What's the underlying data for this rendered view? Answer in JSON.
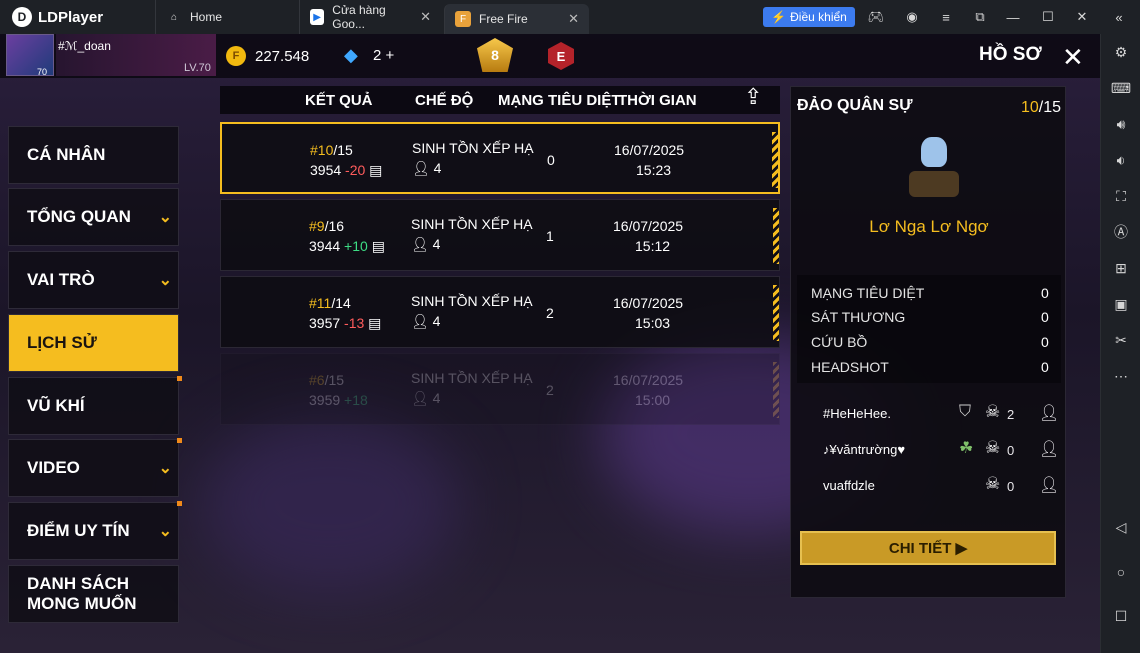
{
  "app": {
    "name": "LDPlayer"
  },
  "tabs": [
    {
      "label": "Home",
      "icon": "home-icon"
    },
    {
      "label": "Cửa hàng Goo...",
      "icon": "play-store-icon"
    },
    {
      "label": "Free Fire",
      "icon": "free-fire-icon"
    }
  ],
  "window": {
    "control_label": "Điều khiển"
  },
  "profile": {
    "name": "#ℳ_doan",
    "level_badge": "70",
    "level": "LV.70",
    "coins": "227.548",
    "diamonds": "2",
    "rank_number": "8",
    "rank_letter": "E",
    "page_title": "HỒ SƠ"
  },
  "menu": [
    "CÁ NHÂN",
    "TỔNG QUAN",
    "VAI TRÒ",
    "LỊCH SỬ",
    "VŨ KHÍ",
    "VIDEO",
    "ĐIỂM UY TÍN",
    "DANH SÁCH MONG MUỐN"
  ],
  "table": {
    "headers": [
      "KẾT QUẢ",
      "CHẾ ĐỘ",
      "MẠNG TIÊU DIỆT",
      "THỜI GIAN"
    ],
    "rows": [
      {
        "place": "#10",
        "total": "/15",
        "points": "3954",
        "delta": "-20",
        "mode": "SINH TỒN XẾP HẠ",
        "squad": "4",
        "kills": "0",
        "date": "16/07/2025",
        "time": "15:23"
      },
      {
        "place": "#9",
        "total": "/16",
        "points": "3944",
        "delta": "+10",
        "mode": "SINH TỒN XẾP HẠ",
        "squad": "4",
        "kills": "1",
        "date": "16/07/2025",
        "time": "15:12"
      },
      {
        "place": "#11",
        "total": "/14",
        "points": "3957",
        "delta": "-13",
        "mode": "SINH TỒN XẾP HẠ",
        "squad": "4",
        "kills": "2",
        "date": "16/07/2025",
        "time": "15:03"
      },
      {
        "place": "#6",
        "total": "/15",
        "points": "3959",
        "delta": "+18",
        "mode": "SINH TỒN XẾP HẠ",
        "squad": "4",
        "kills": "2",
        "date": "16/07/2025",
        "time": "15:00"
      }
    ]
  },
  "detail": {
    "map": "ĐẢO QUÂN SỰ",
    "place": "10",
    "total": "/15",
    "subtitle": "Lơ Nga Lơ Ngơ",
    "stats": [
      {
        "label": "MẠNG TIÊU DIỆT",
        "value": "0"
      },
      {
        "label": "SÁT THƯƠNG",
        "value": "0"
      },
      {
        "label": "CỨU BỒ",
        "value": "0"
      },
      {
        "label": "HEADSHOT",
        "value": "0"
      }
    ],
    "mates": [
      {
        "name": "#HeHeHee.",
        "kills": "2"
      },
      {
        "name": "♪¥văntrường♥",
        "kills": "0"
      },
      {
        "name": "vuaffdzle",
        "kills": "0"
      }
    ],
    "button": "CHI TIẾT"
  },
  "colors": {
    "accent": "#f5bd1f",
    "loss": "#ff5c5c",
    "gain": "#3ddc84"
  }
}
